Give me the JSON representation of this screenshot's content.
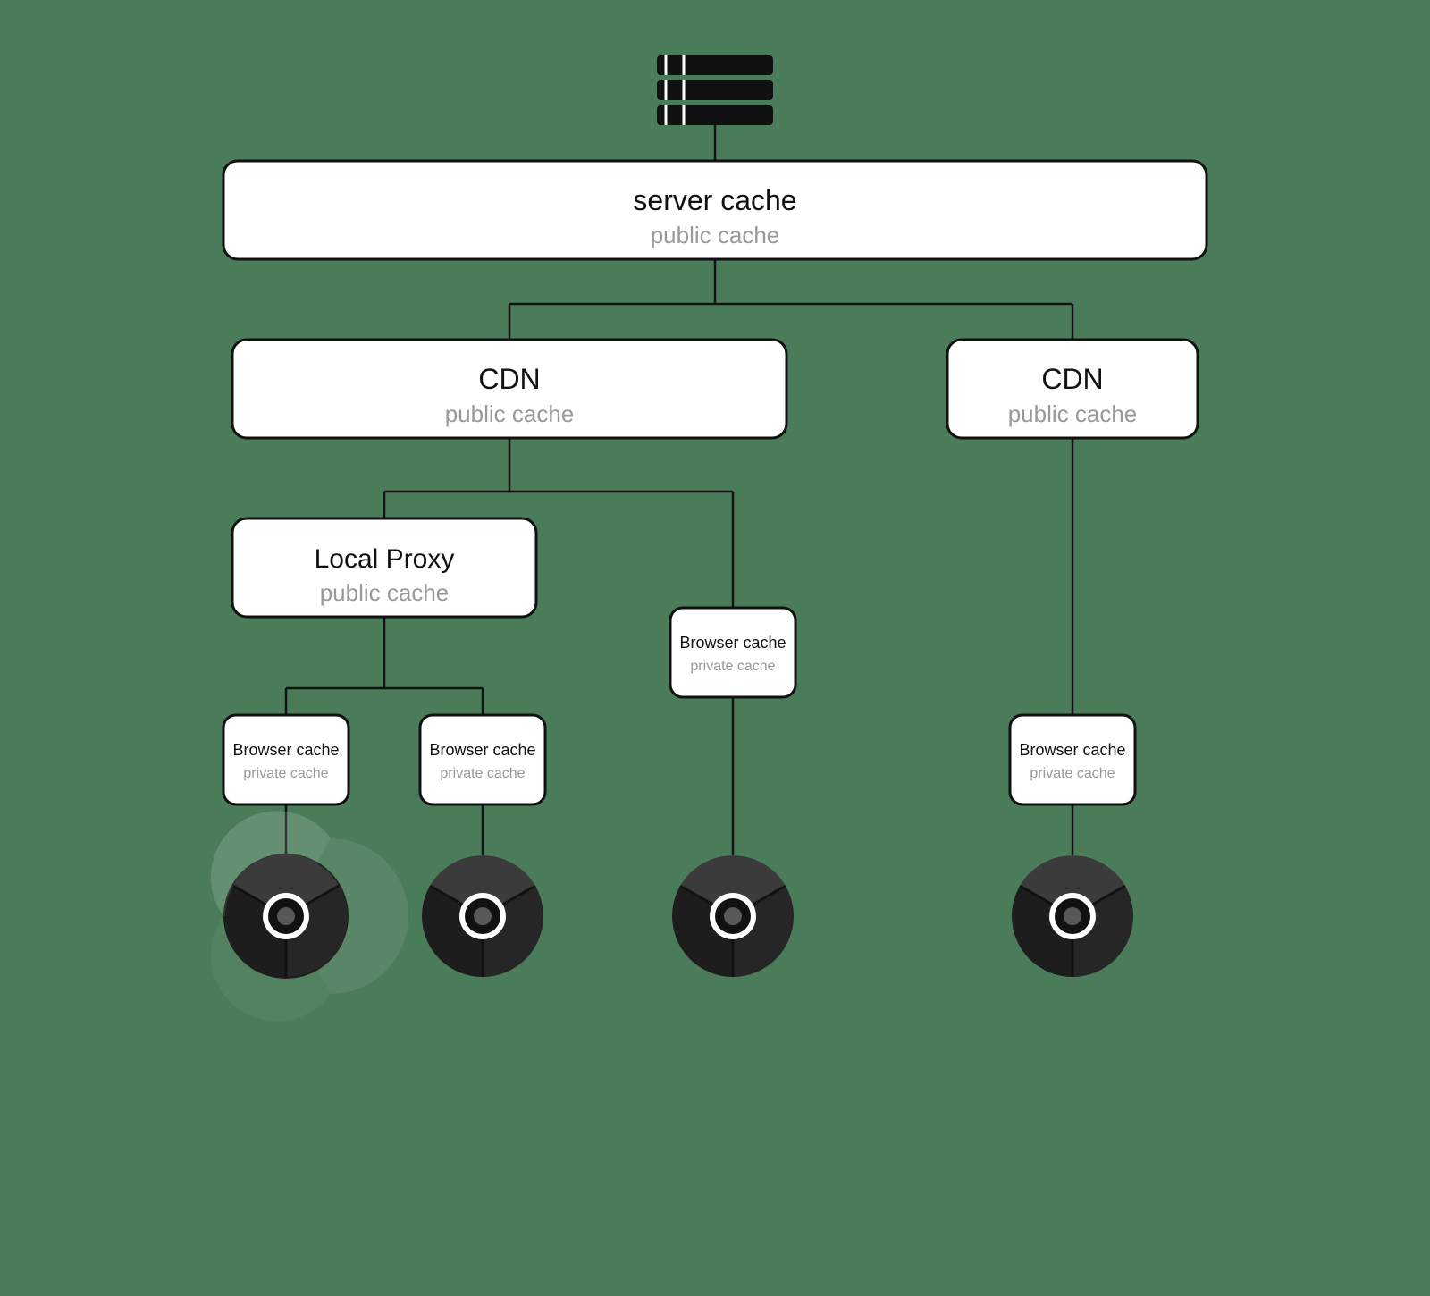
{
  "diagram": {
    "background_color": "#4a7c59",
    "server": {
      "label": "server cache",
      "sublabel": "public cache"
    },
    "cdn_left": {
      "label": "CDN",
      "sublabel": "public cache"
    },
    "cdn_right": {
      "label": "CDN",
      "sublabel": "public cache"
    },
    "local_proxy": {
      "label": "Local Proxy",
      "sublabel": "public cache"
    },
    "browser_caches": [
      {
        "label": "Browser cache",
        "sublabel": "private cache"
      },
      {
        "label": "Browser cache",
        "sublabel": "private cache"
      },
      {
        "label": "Browser cache",
        "sublabel": "private cache"
      },
      {
        "label": "Browser cache",
        "sublabel": "private cache"
      }
    ]
  }
}
